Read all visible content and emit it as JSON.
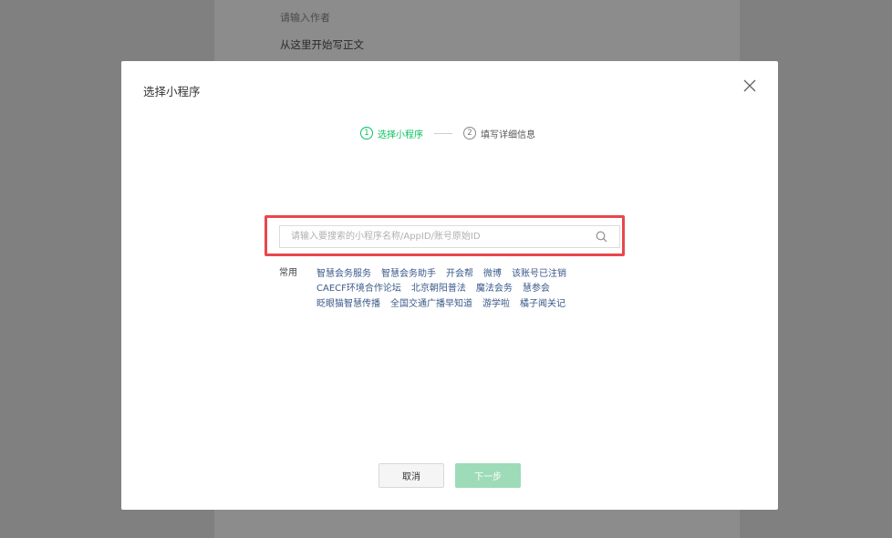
{
  "background": {
    "author_placeholder": "请输入作者",
    "body_placeholder": "从这里开始写正文"
  },
  "modal": {
    "title": "选择小程序",
    "close_icon": "close-icon",
    "steps": [
      {
        "num": "1",
        "label": "选择小程序",
        "active": true
      },
      {
        "num": "2",
        "label": "填写详细信息",
        "active": false
      }
    ],
    "search": {
      "placeholder": "请输入要搜索的小程序名称/AppID/账号原始ID",
      "value": "",
      "icon": "search-icon"
    },
    "common": {
      "label": "常用",
      "rows": [
        [
          "智慧会务服务",
          "智慧会务助手",
          "开会帮",
          "微博",
          "该账号已注销"
        ],
        [
          "CAECF环境合作论坛",
          "北京朝阳普法",
          "魔法会务",
          "慧参会"
        ],
        [
          "眨眼猫智慧传播",
          "全国交通广播早知道",
          "游学啦",
          "橘子闻关记"
        ]
      ]
    },
    "buttons": {
      "cancel": "取消",
      "next": "下一步"
    },
    "colors": {
      "accent": "#07c160",
      "highlight": "#e8474c",
      "link": "#3a5a8a",
      "next_disabled": "#9edbb9"
    }
  }
}
